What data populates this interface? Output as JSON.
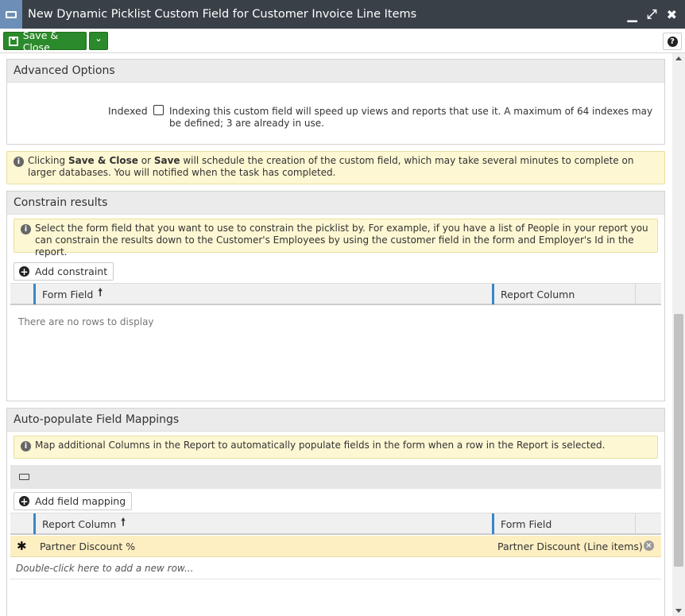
{
  "window": {
    "title": "New Dynamic Picklist Custom Field for Customer Invoice Line Items",
    "controls": {
      "minimize": "▁",
      "maximize": "⤢",
      "close": "✖"
    }
  },
  "toolbar": {
    "save_close_label": "Save & Close",
    "dropdown_glyph": "⌄",
    "help_glyph": "?"
  },
  "advanced": {
    "header": "Advanced Options",
    "indexed_label": "Indexed",
    "indexed_checked": false,
    "indexed_help": "Indexing this custom field will speed up views and reports that use it. A maximum of 64 indexes may be defined; 3 are already in use."
  },
  "notice": {
    "pre": "Clicking ",
    "b1": "Save & Close",
    "mid": " or ",
    "b2": "Save",
    "post": " will schedule the creation of the custom field, which may take several minutes to complete on larger databases. You will notified when the task has completed."
  },
  "constrain": {
    "header": "Constrain results",
    "info": "Select the form field that you want to use to constrain the picklist by. For example, if you have a list of People in your report you can constrain the results down to the Customer's Employees by using the customer field in the form and Employer's Id in the report.",
    "add_button": "Add constraint",
    "columns": [
      "Form Field",
      "Report Column"
    ],
    "empty_text": "There are no rows to display"
  },
  "mappings": {
    "header": "Auto-populate Field Mappings",
    "info": "Map additional Columns in the Report to automatically populate fields in the form when a row in the Report is selected.",
    "add_button": "Add field mapping",
    "columns": [
      "Report Column",
      "Form Field"
    ],
    "rows": [
      {
        "marker": "✱",
        "report_column": "Partner Discount %",
        "form_field": "Partner Discount (Line items)"
      }
    ],
    "new_row_hint": "Double-click here to add a new row..."
  },
  "icons": {
    "info": "info-icon",
    "plus": "plus-circle-icon",
    "remove": "remove-circle-icon",
    "sort": "sort-ascending-icon"
  },
  "colors": {
    "titlebar": "#3a4048",
    "accent_green": "#2b8a2b",
    "notice_bg": "#fdf7d3",
    "selected_row": "#fdefc2",
    "column_marker": "#3a86c8"
  }
}
